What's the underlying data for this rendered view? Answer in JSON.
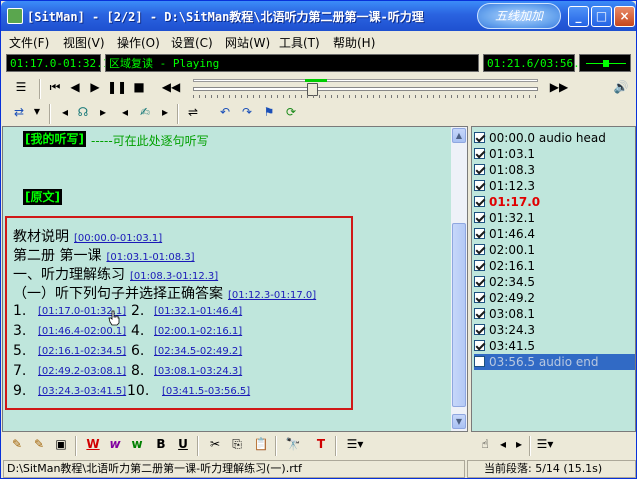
{
  "window": {
    "title": "[SitMan] - [2/2] - D:\\SitMan教程\\北语听力第二册第一课-听力理",
    "ad_logo": "五线加加"
  },
  "menu": [
    "文件(F)",
    "视图(V)",
    "操作(O)",
    "设置(C)",
    "网站(W)",
    "工具(T)",
    "帮助(H)"
  ],
  "display": {
    "range": "01:17.0-01:32.1",
    "mode": "区域复读 - Playing",
    "position": "01:21.6/03:56.5"
  },
  "editor": {
    "my_dictation_title": "[我的听写]",
    "my_dictation_hint": "-----可在此处逐句听写",
    "original_title": "[原文]",
    "lines": [
      {
        "text": "教材说明",
        "link": "[00:00.0-01:03.1]"
      },
      {
        "text": "第二册  第一课",
        "link": "[01:03.1-01:08.3]"
      },
      {
        "text": "一、听力理解练习",
        "link": "[01:08.3-01:12.3]"
      },
      {
        "text": "（一）听下列句子并选择正确答案",
        "link": "[01:12.3-01:17.0]"
      }
    ],
    "items": [
      {
        "n": "1.",
        "link": "[01:17.0-01:32.1]"
      },
      {
        "n": "2.",
        "link": "[01:32.1-01:46.4]"
      },
      {
        "n": "3.",
        "link": "[01:46.4-02:00.1]"
      },
      {
        "n": "4.",
        "link": "[02:00.1-02:16.1]"
      },
      {
        "n": "5.",
        "link": "[02:16.1-02:34.5]"
      },
      {
        "n": "6.",
        "link": "[02:34.5-02:49.2]"
      },
      {
        "n": "7.",
        "link": "[02:49.2-03:08.1]"
      },
      {
        "n": "8.",
        "link": "[03:08.1-03:24.3]"
      },
      {
        "n": "9.",
        "link": "[03:24.3-03:41.5]"
      },
      {
        "n": "10.",
        "link": "[03:41.5-03:56.5]"
      }
    ]
  },
  "segments": [
    {
      "label": "00:00.0  audio head",
      "checked": true
    },
    {
      "label": "01:03.1",
      "checked": true
    },
    {
      "label": "01:08.3",
      "checked": true
    },
    {
      "label": "01:12.3",
      "checked": true
    },
    {
      "label": "01:17.0",
      "checked": true,
      "current": true
    },
    {
      "label": "01:32.1",
      "checked": true
    },
    {
      "label": "01:46.4",
      "checked": true
    },
    {
      "label": "02:00.1",
      "checked": true
    },
    {
      "label": "02:16.1",
      "checked": true
    },
    {
      "label": "02:34.5",
      "checked": true
    },
    {
      "label": "02:49.2",
      "checked": true
    },
    {
      "label": "03:08.1",
      "checked": true
    },
    {
      "label": "03:24.3",
      "checked": true
    },
    {
      "label": "03:41.5",
      "checked": true
    },
    {
      "label": "03:56.5  audio end",
      "checked": false,
      "selected": true
    }
  ],
  "status": {
    "path": "D:\\SitMan教程\\北语听力第二册第一课-听力理解练习(一).rtf",
    "segment": "当前段落: 5/14  (15.1s)"
  },
  "playback": {
    "progress": 0.345,
    "volume": 0.5
  },
  "colors": {
    "editor_bg": "#bfe6dc",
    "accent_green": "#00ff00",
    "highlight_red": "#d01818"
  },
  "icons": {
    "title_buttons": [
      "minimize-icon",
      "maximize-icon",
      "close-icon"
    ],
    "play_toolbar": [
      "list-menu-icon",
      "skip-start-icon",
      "prev-icon",
      "next-icon",
      "pause-icon",
      "stop-icon",
      "rewind-icon",
      "fast-forward-icon",
      "speaker-icon"
    ],
    "edit_toolbar": [
      "repeat-mode-icon",
      "repeat-dropdown-icon",
      "step-back-icon",
      "listen-icon",
      "step-forward-icon",
      "step-back2-icon",
      "dictate-icon",
      "step-forward2-icon",
      "segment-split-icon",
      "undo-icon",
      "redo-icon",
      "flag-icon",
      "refresh-icon"
    ],
    "format_toolbar": [
      "format-a-icon",
      "format-b-icon",
      "format-c-icon",
      "red-w-icon",
      "purple-w-icon",
      "green-w-icon",
      "bold-icon",
      "underline-icon",
      "cut-icon",
      "copy-icon",
      "paste-icon",
      "find-icon",
      "highlight-icon",
      "list-dropdown-icon",
      "hand-icon",
      "nav-left-icon",
      "nav-right-icon",
      "list-dropdown2-icon"
    ]
  }
}
